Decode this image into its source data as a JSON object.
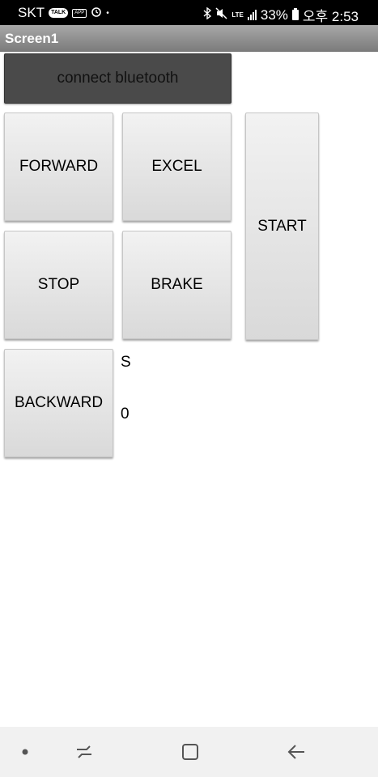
{
  "status_bar": {
    "carrier": "SKT",
    "talk_badge": "TALK",
    "app_badge": "APP",
    "lte": "LTE",
    "battery_percent": "33%",
    "time": "오후 2:53"
  },
  "title_bar": {
    "title": "Screen1"
  },
  "buttons": {
    "connect": "connect bluetooth",
    "forward": "FORWARD",
    "excel": "EXCEL",
    "start": "START",
    "stop": "STOP",
    "brake": "BRAKE",
    "backward": "BACKWARD"
  },
  "labels": {
    "status_text": "S",
    "value_text": "0"
  },
  "nav_bar": {
    "items": [
      "dot-icon",
      "recent-apps-icon",
      "home-icon",
      "back-icon"
    ]
  },
  "colors": {
    "status_bar_bg": "#000000",
    "title_bar_bg": "#8f8f8f",
    "connect_button_bg": "#4a4a4a",
    "button_bg": "#e6e6e6",
    "nav_bar_bg": "#f1f1f1"
  }
}
